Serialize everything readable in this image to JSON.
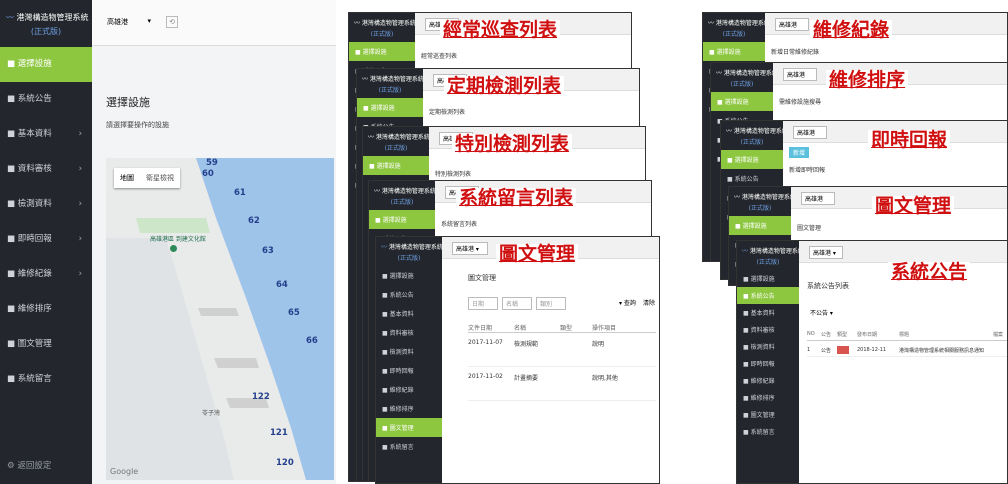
{
  "main": {
    "title": "港灣構造物管理系統",
    "subtitle": "(正式版)",
    "sidebar": [
      {
        "label": "選擇設施",
        "active": true,
        "arrow": ""
      },
      {
        "label": "系統公告",
        "active": false,
        "arrow": ""
      },
      {
        "label": "基本資料",
        "active": false,
        "arrow": "›"
      },
      {
        "label": "資料審核",
        "active": false,
        "arrow": "›"
      },
      {
        "label": "檢測資料",
        "active": false,
        "arrow": "›"
      },
      {
        "label": "即時回報",
        "active": false,
        "arrow": "›"
      },
      {
        "label": "維修紀錄",
        "active": false,
        "arrow": "›"
      },
      {
        "label": "維修排序",
        "active": false,
        "arrow": ""
      },
      {
        "label": "圖文管理",
        "active": false,
        "arrow": ""
      },
      {
        "label": "系統留言",
        "active": false,
        "arrow": ""
      }
    ],
    "footer": "返回設定",
    "select_value": "高雄港",
    "heading": "選擇設施",
    "instruction": "請選擇要操作的設施",
    "map_tabs": [
      "地圖",
      "衛星檢視"
    ],
    "map_poi": "高雄港區 到建文化館",
    "map_area": "苓子灣",
    "google": "Google",
    "wharf_numbers": [
      "59",
      "60",
      "61",
      "62",
      "63",
      "64",
      "65",
      "66",
      "122",
      "121",
      "120"
    ]
  },
  "stack1": {
    "banners": [
      "經常巡查列表",
      "定期檢測列表",
      "特別檢測列表",
      "系統留言列表",
      "圖文管理"
    ],
    "page_titles": [
      "經常巡查列表",
      "定期檢測列表",
      "特別檢測列表",
      "系統留言列表"
    ],
    "front": {
      "title": "港灣構造物管理系統",
      "subtitle": "(正式版)",
      "select_value": "高雄港",
      "heading": "圖文管理",
      "search_button": "查詢",
      "clear_button": "清除",
      "filters": [
        "日期",
        "名稱",
        "類別"
      ],
      "columns": [
        "文件日期",
        "名稱",
        "類型",
        "操作項目"
      ],
      "rows": [
        [
          "2017-11-07",
          "檢測規範",
          "",
          "說明"
        ],
        [
          "2017-11-02",
          "計畫摘要",
          "",
          "說明,其他"
        ]
      ],
      "sidebar": [
        "選擇設施",
        "系統公告",
        "基本資料",
        "資料審核",
        "檢測資料",
        "即時回報",
        "維修紀錄",
        "維修排序",
        "圖文管理",
        "系統留言"
      ],
      "footer": "返回設定"
    }
  },
  "stack2": {
    "banners": [
      "維修紀錄",
      "維修排序",
      "即時回報",
      "圖文管理",
      "系統公告"
    ],
    "page_titles": [
      "新增日常維修紀錄",
      "需維修設施搜尋",
      "新增即時回報",
      "圖文管理",
      "系統公告列表"
    ],
    "front": {
      "title": "港灣構造物管理系統",
      "subtitle": "(正式版)",
      "select_value": "高雄港",
      "filter_value": "不公告",
      "columns": [
        "NO",
        "公告",
        "類型",
        "發布日期",
        "標題",
        "檔案"
      ],
      "row": [
        "1",
        "公告",
        "",
        "2018-12-11",
        "港灣構造物管理系統相關服務訊息通知"
      ],
      "sidebar": [
        "選擇設施",
        "系統公告",
        "基本資料",
        "資料審核",
        "檢測資料",
        "即時回報",
        "維修紀錄",
        "維修排序",
        "圖文管理",
        "系統留言"
      ],
      "footer": "返回設定"
    },
    "add_button": "新增"
  },
  "colors": {
    "accent": "#8dc63f",
    "sidebar": "#23262c",
    "banner": "#d01010",
    "badge": "#d9534f"
  }
}
